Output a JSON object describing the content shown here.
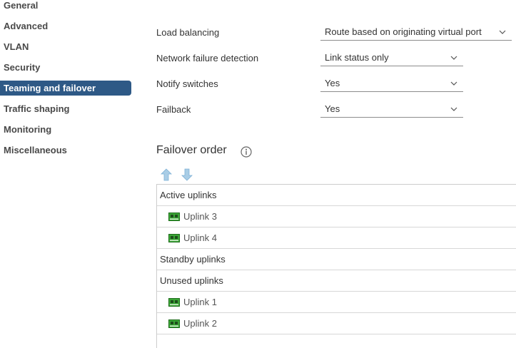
{
  "sidebar": {
    "items": [
      {
        "label": "General"
      },
      {
        "label": "Advanced"
      },
      {
        "label": "VLAN"
      },
      {
        "label": "Security"
      },
      {
        "label": "Teaming and failover",
        "active": true
      },
      {
        "label": "Traffic shaping"
      },
      {
        "label": "Monitoring"
      },
      {
        "label": "Miscellaneous"
      }
    ]
  },
  "form": {
    "load_balancing": {
      "label": "Load balancing",
      "value": "Route based on originating virtual port"
    },
    "network_failure_detection": {
      "label": "Network failure detection",
      "value": "Link status only"
    },
    "notify_switches": {
      "label": "Notify switches",
      "value": "Yes"
    },
    "failback": {
      "label": "Failback",
      "value": "Yes"
    }
  },
  "failover": {
    "title": "Failover order",
    "groups": {
      "active": "Active uplinks",
      "standby": "Standby uplinks",
      "unused": "Unused uplinks"
    },
    "uplinks": {
      "u3": "Uplink 3",
      "u4": "Uplink 4",
      "u1": "Uplink 1",
      "u2": "Uplink 2"
    }
  },
  "colors": {
    "active_nav": "#2e5986",
    "arrow": "#a9cde6",
    "nic_green": "#3aa535"
  },
  "icons": [
    "chevron-down-icon",
    "info-icon",
    "move-up-icon",
    "move-down-icon",
    "network-adapter-icon"
  ]
}
